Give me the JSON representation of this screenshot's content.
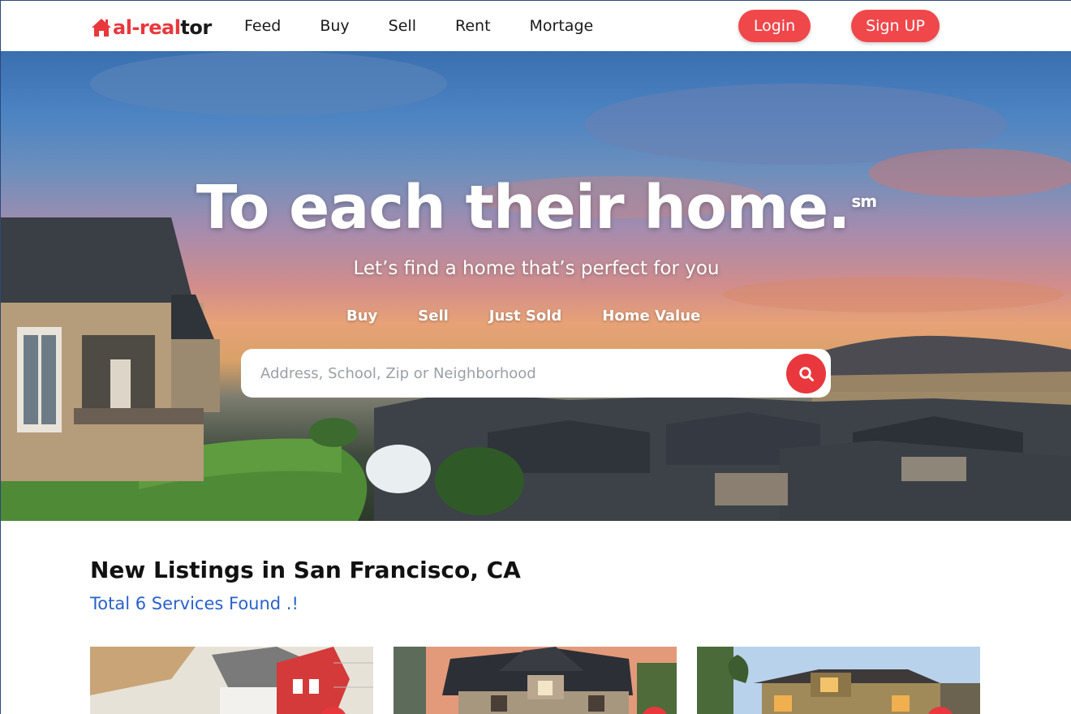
{
  "brand": {
    "part1": "al-real",
    "part2": "tor",
    "accent": "#e8383d"
  },
  "nav": {
    "links": [
      "Feed",
      "Buy",
      "Sell",
      "Rent",
      "Mortage"
    ]
  },
  "auth": {
    "login": "Login",
    "signup": "Sign UP"
  },
  "hero": {
    "title": "To each their home.",
    "title_mark": "sm",
    "subtitle": "Let’s find a home that’s perfect for you",
    "tabs": [
      "Buy",
      "Sell",
      "Just Sold",
      "Home Value"
    ],
    "search_placeholder": "Address, School, Zip or Neighborhood"
  },
  "listings": {
    "heading": "New Listings in San Francisco, CA",
    "count_text": "Total 6 Services Found .!",
    "link_color": "#2a62c9",
    "cards": [
      {
        "image": "house-model-blueprint"
      },
      {
        "image": "suburban-house-sunset"
      },
      {
        "image": "craftsman-house-dusk"
      }
    ]
  }
}
